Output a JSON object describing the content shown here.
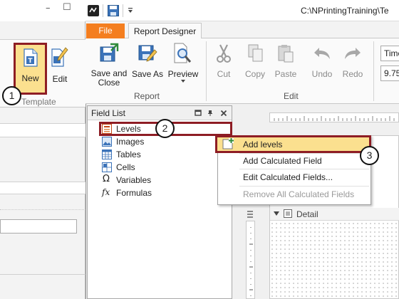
{
  "background_window": {
    "ribbon": {
      "new_label": "New",
      "edit_label": "Edit",
      "group_label": "Template"
    },
    "window_buttons": {
      "minimize": "–",
      "maximize": "☐"
    }
  },
  "designer_window": {
    "title": "C:\\NPrintingTraining\\Te",
    "tabs": [
      {
        "label": "File"
      },
      {
        "label": "Report Designer"
      }
    ],
    "ribbon": {
      "report_group": {
        "label": "Report",
        "buttons": [
          {
            "label": "Save and Close"
          },
          {
            "label": "Save As"
          },
          {
            "label": "Preview"
          }
        ]
      },
      "edit_group": {
        "label": "Edit",
        "buttons": [
          {
            "label": "Cut"
          },
          {
            "label": "Copy"
          },
          {
            "label": "Paste"
          },
          {
            "label": "Undo"
          },
          {
            "label": "Redo"
          }
        ]
      },
      "font": {
        "name": "Time",
        "size": "9.75"
      }
    }
  },
  "field_list": {
    "title": "Field List",
    "items": [
      {
        "label": "Levels",
        "icon": "levels-icon"
      },
      {
        "label": "Images",
        "icon": "images-icon"
      },
      {
        "label": "Tables",
        "icon": "tables-icon"
      },
      {
        "label": "Cells",
        "icon": "cells-icon"
      },
      {
        "label": "Variables",
        "icon": "omega-icon",
        "glyph": "Ω"
      },
      {
        "label": "Formulas",
        "icon": "fx-icon",
        "glyph": "fx"
      }
    ]
  },
  "context_menu": {
    "items": [
      {
        "label": "Add levels",
        "enabled": true,
        "highlighted": true
      },
      {
        "label": "Add Calculated Field",
        "enabled": true
      },
      {
        "label": "Edit Calculated Fields...",
        "enabled": true
      },
      {
        "label": "Remove All Calculated Fields",
        "enabled": false
      }
    ]
  },
  "design_surface": {
    "band_label": "Detail"
  },
  "callouts": [
    "1",
    "2",
    "3"
  ],
  "colors": {
    "highlight_border": "#8e1d24",
    "highlight_fill": "#fbe08f",
    "file_tab": "#f47e1f"
  }
}
